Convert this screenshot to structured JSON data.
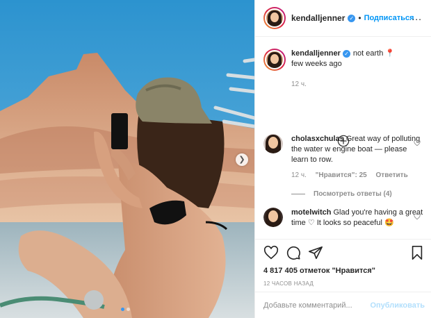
{
  "colors": {
    "accent": "#0095f6",
    "verified": "#3897f0",
    "text": "#262626",
    "muted": "#8e8e8e",
    "border": "#efefef"
  },
  "post": {
    "image_alt": "photo",
    "carousel": {
      "total_slides": 2,
      "active_slide": 1,
      "next_icon": "chevron-right-icon"
    }
  },
  "header": {
    "username": "kendalljenner",
    "separator": "•",
    "follow_label": "Подписаться",
    "more_icon": "more-options-icon",
    "more_label": "..."
  },
  "caption": {
    "username": "kendalljenner",
    "text": "not earth 📍",
    "line2": "few weeks ago",
    "time": "12 ч."
  },
  "load_more_icon": "plus-circle-icon",
  "comments": [
    {
      "username": "cholasxchulas",
      "text": "Great way of polluting the water w engine boat — please learn to row.",
      "time": "12 ч.",
      "likes": "\"Нравится\": 25",
      "reply": "Ответить",
      "view_replies": "Посмотреть ответы (4)"
    },
    {
      "username": "motelwitch",
      "text": "Glad you're having a great time ♡ It looks so peaceful 🤩"
    }
  ],
  "actions": {
    "icons": [
      "heart-icon",
      "comment-icon",
      "share-icon",
      "bookmark-icon"
    ],
    "likes_text": "4 817 405 отметок \"Нравится\"",
    "timestamp": "12 ЧАСОВ НАЗАД"
  },
  "add_comment": {
    "placeholder": "Добавьте комментарий...",
    "post_label": "Опубликовать"
  }
}
